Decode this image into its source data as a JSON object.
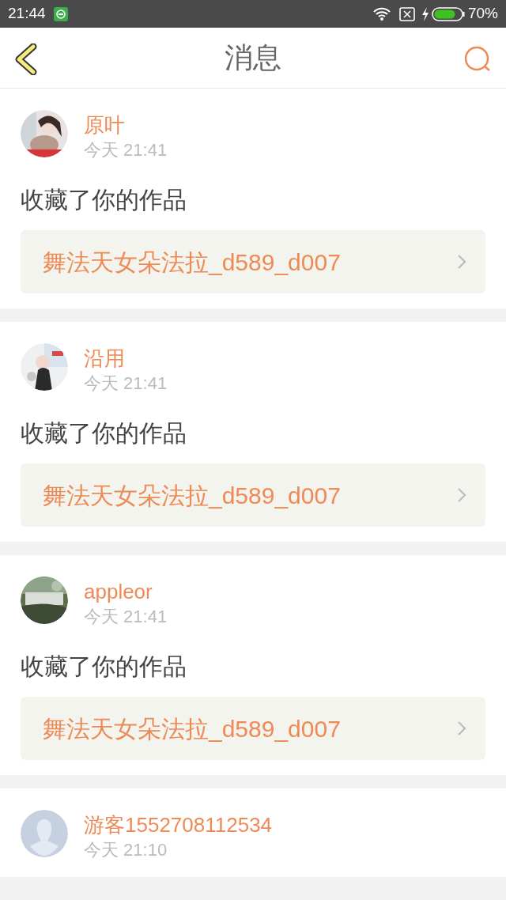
{
  "status_bar": {
    "time": "21:44",
    "battery": "70%"
  },
  "header": {
    "title": "消息"
  },
  "messages": [
    {
      "name": "原叶",
      "time": "今天 21:41",
      "action": "收藏了你的作品",
      "work": "舞法天女朵法拉_d589_d007"
    },
    {
      "name": "沿用",
      "time": "今天 21:41",
      "action": "收藏了你的作品",
      "work": "舞法天女朵法拉_d589_d007"
    },
    {
      "name": "appleor",
      "time": "今天 21:41",
      "action": "收藏了你的作品",
      "work": "舞法天女朵法拉_d589_d007"
    },
    {
      "avatar": {
        "kind": "default"
      },
      "name": "游客1552708112534",
      "time": "今天 21:10"
    }
  ]
}
